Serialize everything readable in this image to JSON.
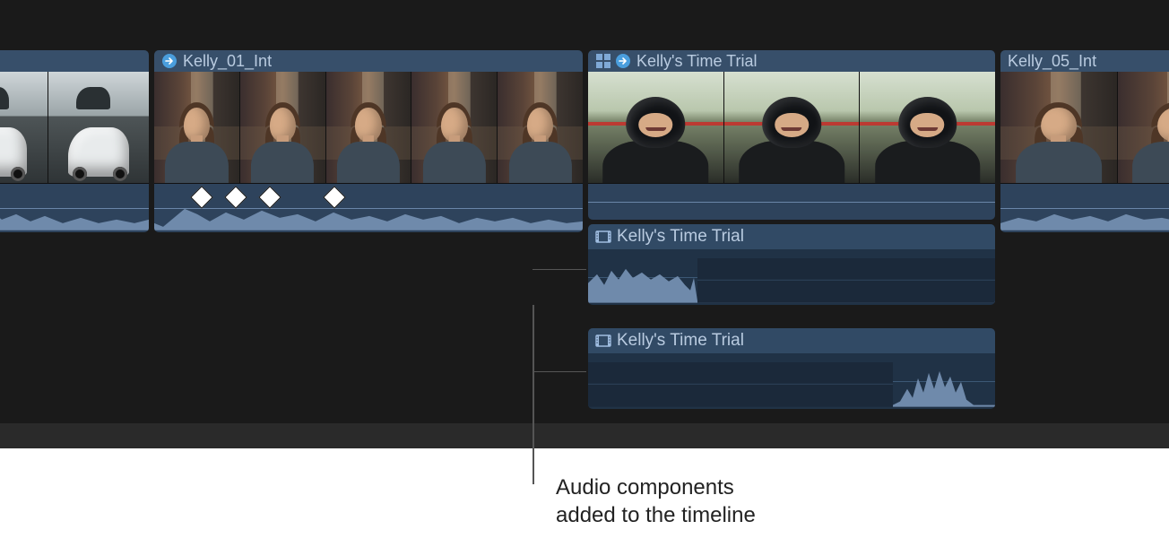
{
  "colors": {
    "timeline_bg": "#1a1a1a",
    "clip_bg": "#2e435c",
    "clip_header_bg": "#374f6a",
    "clip_text": "#b9cbe0",
    "audio_midline": "#6a86a8",
    "waveform_fill": "#6f8aab",
    "annotation_line": "#555555",
    "annotation_text": "#222222"
  },
  "timeline": {
    "clips": [
      {
        "id": "clip1_partial_left",
        "title": ""
      },
      {
        "id": "clip2",
        "title": "Kelly_01_Int"
      },
      {
        "id": "clip3_compound",
        "title": "Kelly's Time Trial"
      },
      {
        "id": "clip4_partial_right",
        "title": "Kelly_05_Int"
      }
    ],
    "audio_components": [
      {
        "id": "audio_comp_1",
        "title": "Kelly's Time Trial"
      },
      {
        "id": "audio_comp_2",
        "title": "Kelly's Time Trial"
      }
    ],
    "keyframe_count_on_clip2": 4
  },
  "icons": {
    "transition": "transition-arrow-icon",
    "compound": "compound-clip-icon",
    "film": "film-strip-icon"
  },
  "annotation": {
    "line1": "Audio components",
    "line2": "added to the timeline"
  }
}
